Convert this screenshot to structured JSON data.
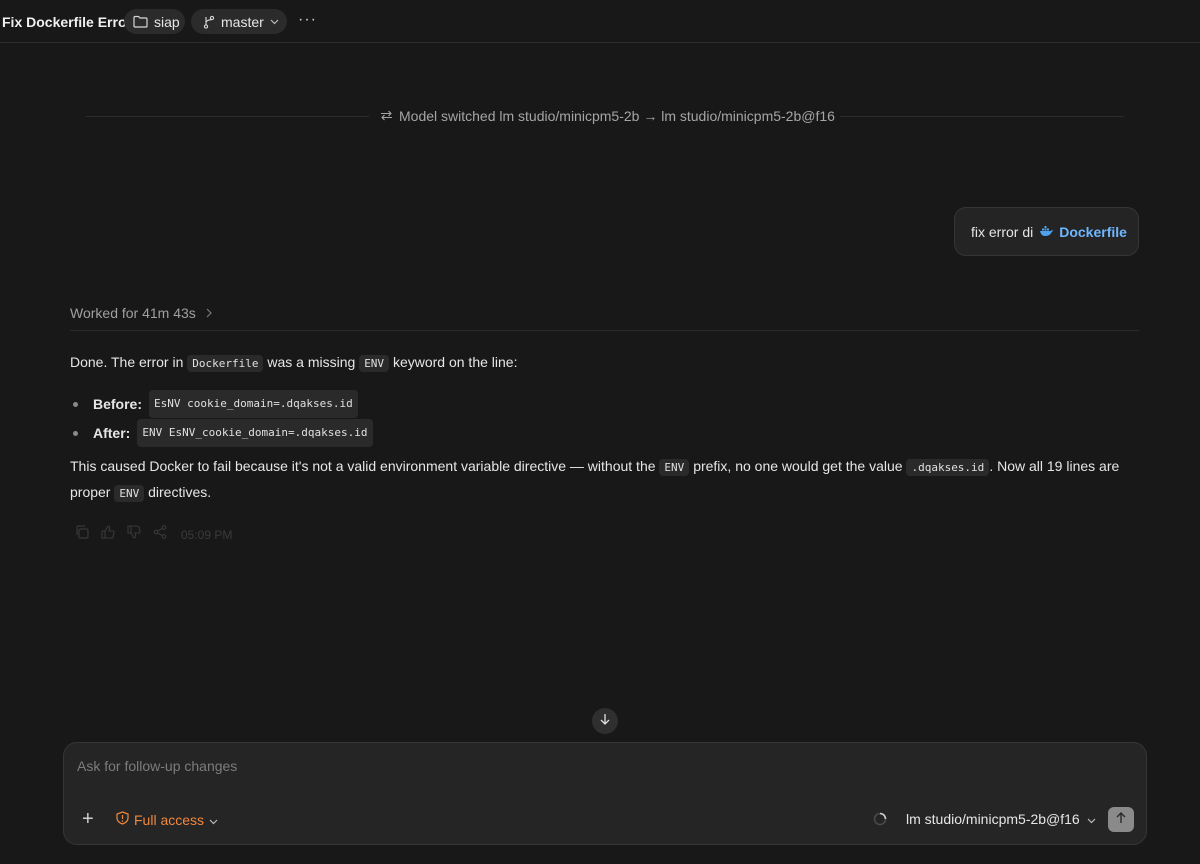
{
  "header": {
    "title": "Fix Dockerfile Error",
    "repo_label": "siap",
    "branch_label": "master",
    "more_label": "···"
  },
  "divider": {
    "text": "Model switched lm studio/minicpm5-2b → lm studio/minicpm5-2b@f16"
  },
  "user_message": {
    "text": "fix error di",
    "file_label": "Dockerfile"
  },
  "worked": {
    "label": "Worked for 41m 43s"
  },
  "answer": {
    "p1_a": "Done. The error in",
    "p1_code1": "Dockerfile",
    "p1_b": "was a missing",
    "p1_code2": "ENV",
    "p1_c": "keyword on the line:",
    "before_label": "Before:",
    "before_code": "EsNV cookie_domain=.dqakses.id",
    "after_label": "After:",
    "after_code": "ENV EsNV_cookie_domain=.dqakses.id",
    "p2_a": "This caused Docker to fail because it's not a valid environment variable directive — without the",
    "p2_code1": "ENV",
    "p2_b": "prefix, no one would get the value",
    "p2_code2": ".dqakses.id",
    "p2_c": ". Now all 19 lines are proper",
    "p2_code3": "ENV",
    "p2_d": "directives."
  },
  "feedback": {
    "time": "05:09 PM"
  },
  "composer": {
    "placeholder": "Ask for follow-up changes",
    "plus_label": "+",
    "access_label": "Full access",
    "model_label": "lm studio/minicpm5-2b@f16"
  },
  "colors": {
    "background": "#181818",
    "accent_orange": "#f0883e",
    "link_blue": "#6fb6ff"
  }
}
